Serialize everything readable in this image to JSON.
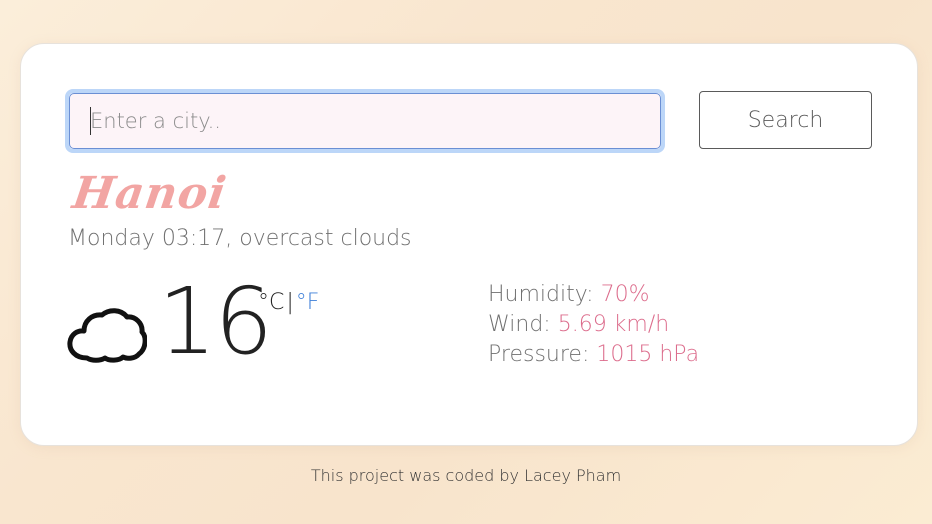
{
  "search": {
    "placeholder": "Enter a city..",
    "value": "",
    "button_label": "Search"
  },
  "weather": {
    "city": "Hanoi",
    "day_time": "Monday 03:17",
    "description": "overcast clouds",
    "icon": "cloud-icon",
    "temperature": "16",
    "unit_celsius": "°C",
    "unit_separator": "|",
    "unit_fahrenheit": "°F"
  },
  "details": {
    "humidity_label": "Humidity:",
    "humidity_value": "70%",
    "wind_label": "Wind:",
    "wind_value": "5.69 km/h",
    "pressure_label": "Pressure:",
    "pressure_value": "1015 hPa"
  },
  "footer": {
    "text": "This project was coded by Lacey Pham"
  },
  "colors": {
    "city": "#f2a5a3",
    "detail_value": "#dc6c8c",
    "fahrenheit_link": "#3e7fd8",
    "input_focus_ring": "#bcd6f8"
  }
}
